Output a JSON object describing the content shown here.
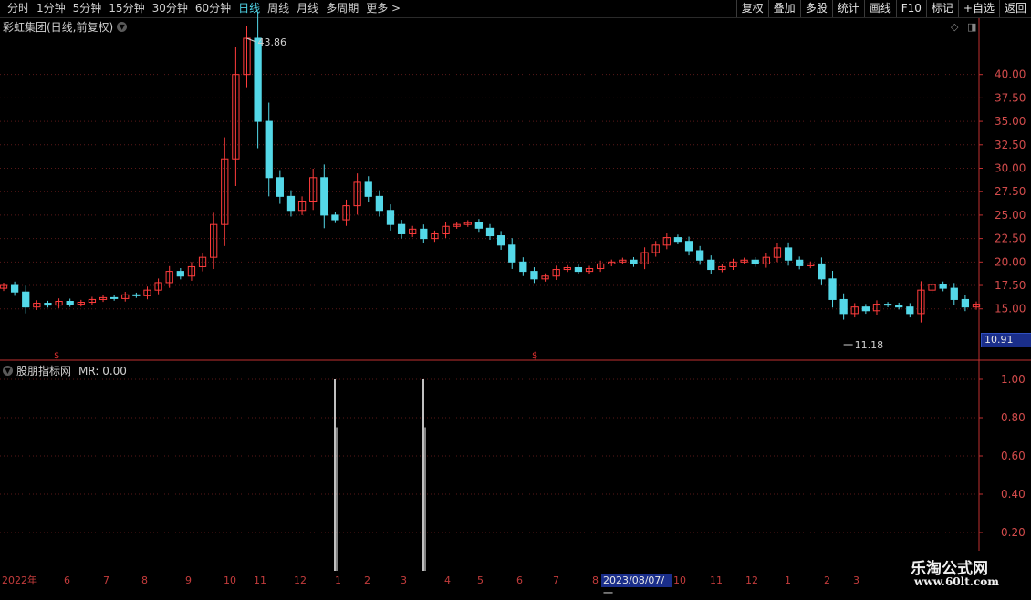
{
  "toolbar": {
    "periods": [
      "分时",
      "1分钟",
      "5分钟",
      "15分钟",
      "30分钟",
      "60分钟",
      "日线",
      "周线",
      "月线",
      "多周期",
      "更多 >"
    ],
    "active_period": "日线",
    "buttons": [
      "复权",
      "叠加",
      "多股",
      "统计",
      "画线",
      "F10",
      "标记",
      "+自选",
      "返回"
    ]
  },
  "main_chart": {
    "stock_title": "彩虹集团(日线,前复权)",
    "high_label": "43.86",
    "low_label": "11.18",
    "current_price_tag": "10.91",
    "y_ticks": [
      "40.00",
      "37.50",
      "35.00",
      "32.50",
      "30.00",
      "27.50",
      "25.00",
      "22.50",
      "20.00",
      "17.50",
      "15.00"
    ],
    "up_color": "#ff3c3c",
    "down_color": "#54d8e8"
  },
  "indicator": {
    "title": "股朋指标网",
    "mr_label": "MR: 0.00",
    "y_ticks": [
      "1.00",
      "0.80",
      "0.60",
      "0.40",
      "0.20"
    ]
  },
  "date_axis": {
    "ticks": [
      "2022年",
      "6",
      "7",
      "8",
      "9",
      "10",
      "11",
      "12",
      "1",
      "2",
      "3",
      "4",
      "5",
      "6",
      "7",
      "8",
      "2023/08/07/一",
      "10",
      "11",
      "12",
      "1",
      "2",
      "3"
    ],
    "highlighted": "2023/08/07/一"
  },
  "watermark": {
    "line1": "乐淘公式网",
    "line2": "www.60lt.com"
  },
  "chart_data": {
    "type": "candlestick",
    "price_ylim": [
      11,
      44
    ],
    "close_series": [
      17.5,
      16.8,
      15.2,
      15.6,
      15.4,
      15.8,
      15.5,
      15.7,
      16.0,
      16.2,
      16.1,
      16.5,
      16.4,
      17.0,
      17.8,
      19.0,
      18.5,
      19.5,
      20.5,
      24,
      31,
      40,
      43.86,
      35,
      29,
      27,
      25.5,
      26.5,
      29,
      25,
      24.5,
      26,
      28.5,
      27,
      25.5,
      24,
      23,
      23.5,
      22.5,
      23,
      23.8,
      24,
      24.2,
      23.6,
      22.8,
      21.8,
      20,
      19,
      18.2,
      18.5,
      19.2,
      19.4,
      19.0,
      19.3,
      19.8,
      20.0,
      20.2,
      19.8,
      21.0,
      21.8,
      22.6,
      22.2,
      21.2,
      20.2,
      19.2,
      19.5,
      20.0,
      20.2,
      19.8,
      20.5,
      21.5,
      20.2,
      19.6,
      19.8,
      18.2,
      16.0,
      14.5,
      15.2,
      14.8,
      15.5,
      15.4,
      15.2,
      14.5,
      17.0,
      17.6,
      17.2,
      16.0,
      15.2,
      15.5
    ],
    "indicator_spikes": [
      {
        "date_index": 1,
        "value": 1.0
      },
      {
        "date_index": 2,
        "value": 1.0
      }
    ]
  }
}
